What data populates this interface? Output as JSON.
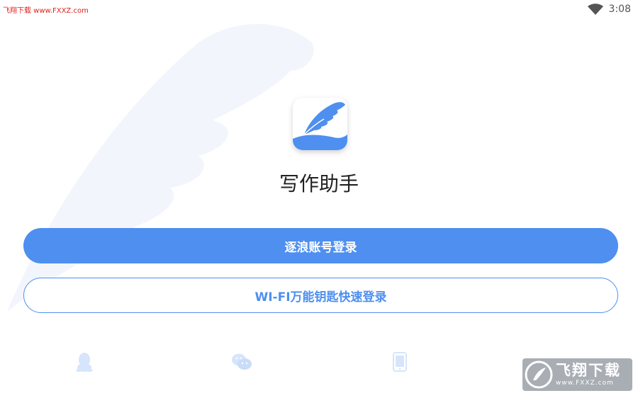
{
  "watermark_top": "飞翔下载 www.FXXZ.com",
  "status_bar": {
    "time": "3:08",
    "wifi_icon": "wifi-icon"
  },
  "app": {
    "title": "写作助手",
    "icon": "feather-app-icon"
  },
  "buttons": {
    "primary_label": "逐浪账号登录",
    "secondary_label": "WI-FI万能钥匙快速登录"
  },
  "social_login": [
    {
      "icon": "qq-icon"
    },
    {
      "icon": "wechat-icon"
    },
    {
      "icon": "phone-icon"
    }
  ],
  "watermark_logo": {
    "main": "飞翔下载",
    "sub": "www.FXXZ.com"
  },
  "colors": {
    "accent": "#4e8ff0",
    "icon_faint": "#d6e5fb",
    "text": "#222222"
  }
}
